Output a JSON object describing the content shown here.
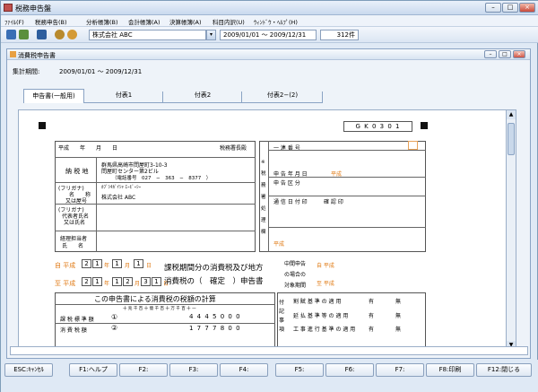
{
  "window": {
    "title": "税務申告盤"
  },
  "menu": [
    "ﾌｧｲﾙ(F)",
    "税務申告(B)",
    "分析帳簿(B)",
    "会計帳簿(A)",
    "決算帳簿(A)",
    "科目内訳(U)",
    "ｳｨﾝﾄﾞｳ・ﾍﾙﾌﾟ(H)"
  ],
  "toolbar": {
    "company": "株式会社 ABC",
    "period": "2009/01/01 〜 2009/12/31",
    "count": "312件"
  },
  "child": {
    "title": "消費税申告書",
    "period_label": "集計期間:",
    "period_value": "2009/01/01 〜 2009/12/31",
    "tabs": [
      "申告書(一般用)",
      "付表1",
      "付表2",
      "付表2−(2)"
    ]
  },
  "form": {
    "code": "G K 0 3 0 1",
    "header": {
      "date_label": "平成　　年　　月　　日",
      "office": "税務署長殿",
      "address_label": "納 税 地",
      "address_line1": "群馬県高崎市問屋町3-10-3",
      "address_line2": "問屋町センター第2ビル",
      "phone": "（電話番号　027　−　363　−　8377　）",
      "furigana_label": "(フリガナ)",
      "name_label1": "名　　称",
      "name_label2": "又は屋号",
      "name_value": "株式会社 ABC",
      "name_kana": "ｶﾌﾞｼｷｶﾞｲｼｬ ｴｰﾋﾞｰｼｰ",
      "rep_label1": "代表者氏名",
      "rep_label2": "又は氏名",
      "acc_label1": "経理担当者",
      "acc_label2": "氏　　名"
    },
    "right": {
      "serial": "一 連 番 号",
      "filed_date": "申 告 年 月 日",
      "category": "申 告 区 分",
      "notice_date": "通 信 日 付 印",
      "confirm": "確 認 印",
      "sidebar": "※ 税 務 署 処 理 欄",
      "heisei": "平成"
    },
    "period": {
      "from_era": "自 平成",
      "from_y": "2",
      "from_y2": "1",
      "from_m": "1",
      "from_d": "1",
      "to_era": "至 平成",
      "to_y": "2",
      "to_y2": "1",
      "to_m": "1",
      "to_m2": "2",
      "to_d": "3",
      "to_d2": "1",
      "nen": "年",
      "tsuki": "月",
      "hi": "日",
      "title1": "課税期間分の消費税及び地方",
      "title2": "消費税の（　確定　）申告書",
      "interim1": "中間申告",
      "interim2": "の場合の",
      "interim3": "対象期間",
      "interim_from": "自 平成",
      "interim_to": "至 平成"
    },
    "calc": {
      "title": "この申告書による消費税の税額の計算",
      "units": "十 兆 千 百 十 億 千 百 十 万 千 百 十 一",
      "row1": "課 税 標 準 額",
      "row1_no": "①",
      "row1_value": "4 4 4 5 0 0 0",
      "row2": "消 費 税 額",
      "row2_no": "②",
      "row2_value": "1 7 7 7 8 0 0",
      "side": "付記事項",
      "r1": "割 賦 基 準 の 適 用",
      "r2": "延 払 基 準 等 の 適 用",
      "r3": "工 事 進 行 基 準 の 適 用",
      "yes": "有",
      "no": "無"
    }
  },
  "fkeys": [
    "ESC:ｷｬﾝｾﾙ",
    "F1:ヘルプ",
    "F2:",
    "F3:",
    "F4:",
    "F5:",
    "F6:",
    "F7:",
    "F8:印刷",
    "F12:閉じる"
  ],
  "icons": [
    "app-icon",
    "save-icon",
    "print-icon",
    "mail-icon",
    "wrench-icon",
    "search-icon",
    "dropdown-icon"
  ]
}
